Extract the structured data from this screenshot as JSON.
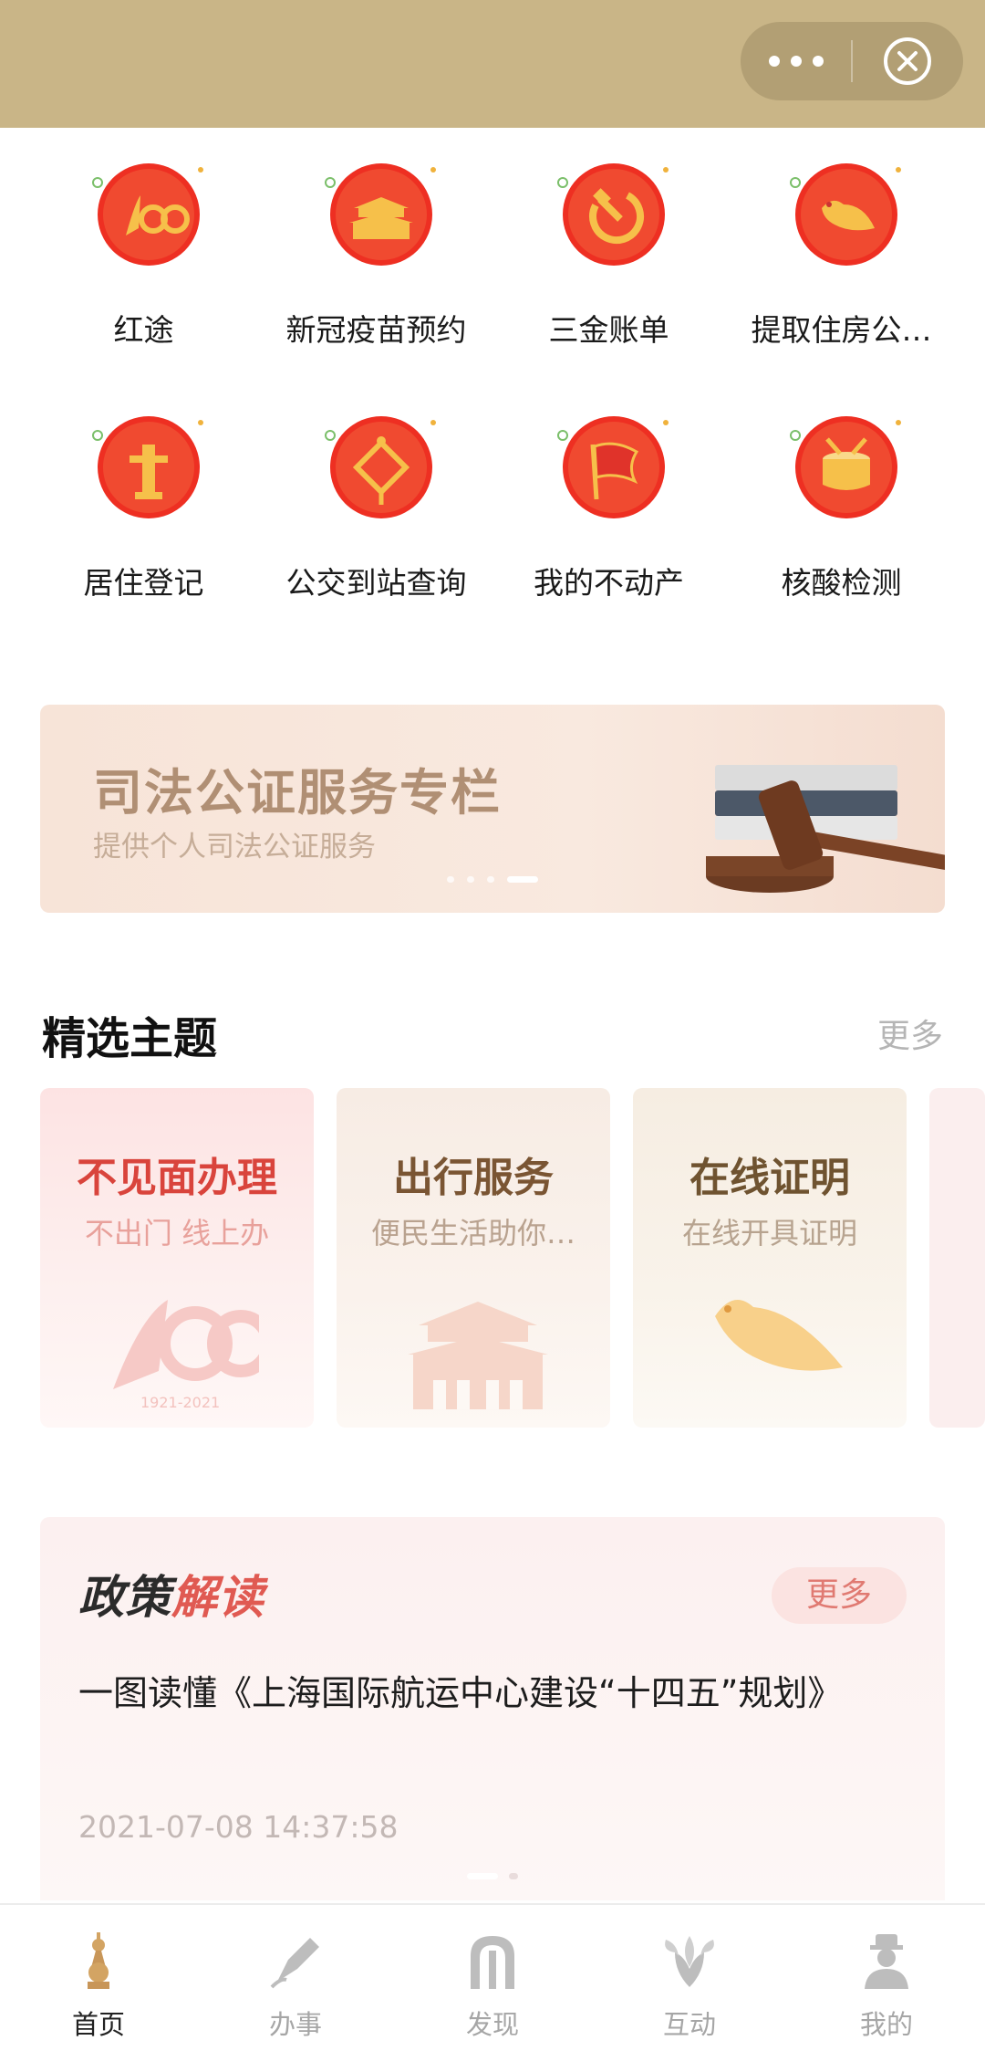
{
  "grid": {
    "items": [
      {
        "label": "红途",
        "icon": "centenary-100-icon"
      },
      {
        "label": "新冠疫苗预约",
        "icon": "tiananmen-icon"
      },
      {
        "label": "三金账单",
        "icon": "hammer-sickle-icon"
      },
      {
        "label": "提取住房公…",
        "icon": "dove-icon"
      },
      {
        "label": "居住登记",
        "icon": "huabiao-pillar-icon"
      },
      {
        "label": "公交到站查询",
        "icon": "chinese-knot-icon"
      },
      {
        "label": "我的不动产",
        "icon": "party-flag-icon"
      },
      {
        "label": "核酸检测",
        "icon": "drum-icon"
      }
    ]
  },
  "banner": {
    "title": "司法公证服务专栏",
    "subtitle": "提供个人司法公证服务",
    "art": "gavel-icon"
  },
  "featured": {
    "title": "精选主题",
    "more": "更多",
    "cards": [
      {
        "title": "不见面办理",
        "subtitle": "不出门 线上办",
        "art_text": "1921-2021",
        "title_color": "#d9443c",
        "subtitle_color": "#e8a19b"
      },
      {
        "title": "出行服务",
        "subtitle": "便民生活助你…",
        "title_color": "#7a5533",
        "subtitle_color": "#b9a28f"
      },
      {
        "title": "在线证明",
        "subtitle": "在线开具证明",
        "title_color": "#6f5330",
        "subtitle_color": "#b7a38f"
      }
    ]
  },
  "policy": {
    "title_a": "政策",
    "title_b": "解读",
    "more": "更多",
    "headline": "一图读懂《上海国际航运中心建设“十四五”规划》",
    "time": "2021-07-08 14:37:58"
  },
  "tabbar": {
    "tabs": [
      {
        "label": "首页",
        "icon": "pearl-tower-icon",
        "active": true
      },
      {
        "label": "办事",
        "icon": "pen-icon",
        "active": false
      },
      {
        "label": "发现",
        "icon": "arch-icon",
        "active": false
      },
      {
        "label": "互动",
        "icon": "magnolia-icon",
        "active": false
      },
      {
        "label": "我的",
        "icon": "person-icon",
        "active": false
      }
    ]
  },
  "colors": {
    "topbar": "#c9b587",
    "accent_red": "#e0332a",
    "gold": "#f0b23c"
  }
}
